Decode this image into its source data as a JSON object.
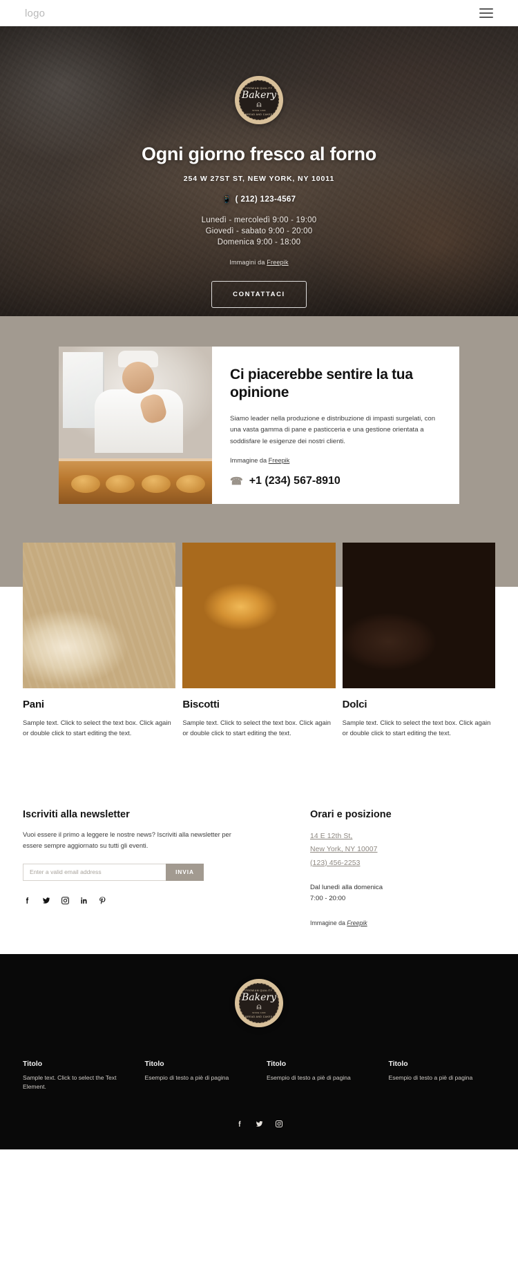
{
  "header": {
    "logo": "logo",
    "menu_icon": "hamburger-menu-icon"
  },
  "hero": {
    "badge": {
      "top_text": "PREMIUM QUALITY",
      "name": "Bakery",
      "since": "SINCE 1930",
      "bottom_text": "BREAD AND CAKES"
    },
    "title": "Ogni giorno fresco al forno",
    "address": "254 W 27ST ST, NEW YORK, NY 10011",
    "phone": "( 212) 123-4567",
    "hours": [
      "Lunedì - mercoledì 9:00 - 19:00",
      "Giovedì - sabato 9:00 - 20:00",
      "Domenica 9:00 - 18:00"
    ],
    "credit_prefix": "Immagini da ",
    "credit_link": "Freepik",
    "cta_label": "CONTATTACI"
  },
  "feature": {
    "title": "Ci piacerebbe sentire la tua opinione",
    "body": "Siamo leader nella produzione e distribuzione di impasti surgelati, con una vasta gamma di pane e pasticceria e una gestione orientata a soddisfare le esigenze dei nostri clienti.",
    "credit_prefix": "Immagine da ",
    "credit_link": "Freepik",
    "phone": "+1 (234) 567-8910",
    "phone_icon": "phone-icon"
  },
  "products": [
    {
      "title": "Pani",
      "text": "Sample text. Click to select the text box. Click again or double click to start editing the text."
    },
    {
      "title": "Biscotti",
      "text": "Sample text. Click to select the text box. Click again or double click to start editing the text."
    },
    {
      "title": "Dolci",
      "text": "Sample text. Click to select the text box. Click again or double click to start editing the text."
    }
  ],
  "newsletter": {
    "title": "Iscriviti alla newsletter",
    "subtitle": "Vuoi essere il primo a leggere le nostre news? Iscriviti alla newsletter per essere sempre aggiornato su tutti gli eventi.",
    "email_placeholder": "Enter a valid email address",
    "email_value": "",
    "submit_label": "INVIA",
    "social_icons": [
      "facebook-icon",
      "twitter-icon",
      "instagram-icon",
      "linkedin-icon",
      "pinterest-icon"
    ]
  },
  "location": {
    "title": "Orari e posizione",
    "address_line1": "14 E 12th St,",
    "address_line2": "New York, NY 10007",
    "phone": "(123) 456-2253",
    "hours_days": "Dal lunedì alla domenica",
    "hours_time": "7:00 - 20:00",
    "credit_prefix": "Immagine da ",
    "credit_link": "Freepik"
  },
  "footer": {
    "badge": {
      "top_text": "PREMIUM QUALITY",
      "name": "Bakery",
      "since": "SINCE 1930",
      "bottom_text": "BREAD AND CAKES"
    },
    "columns": [
      {
        "title": "Titolo",
        "text": "Sample text. Click to select the Text Element."
      },
      {
        "title": "Titolo",
        "text": "Esempio di testo a piè di pagina"
      },
      {
        "title": "Titolo",
        "text": "Esempio di testo a piè di pagina"
      },
      {
        "title": "Titolo",
        "text": "Esempio di testo a piè di pagina"
      }
    ],
    "social_icons": [
      "facebook-icon",
      "twitter-icon",
      "instagram-icon"
    ]
  },
  "colors": {
    "band": "#a29a90",
    "footer_bg": "#090909",
    "accent": "#a29a90",
    "badge_ring": "#d8c09a"
  }
}
